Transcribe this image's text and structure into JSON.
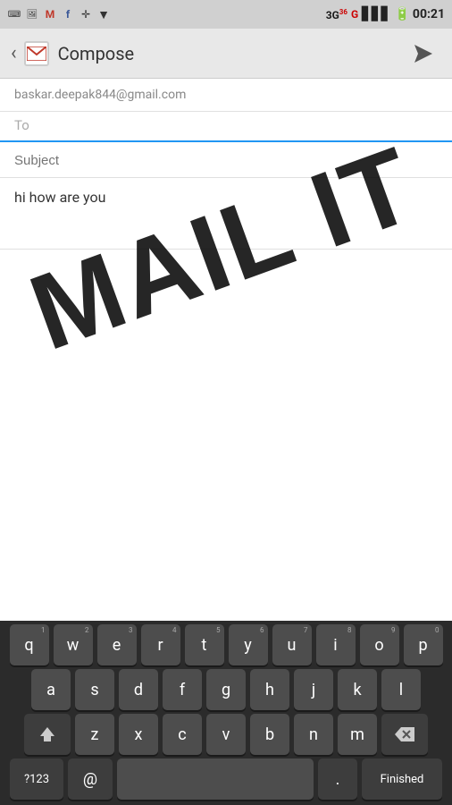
{
  "statusBar": {
    "network": "3G",
    "networkSuperscript": "36",
    "signal": "G",
    "time": "00:21",
    "batteryIcon": "battery"
  },
  "toolbar": {
    "title": "Compose",
    "backIcon": "‹",
    "sendIcon": "send"
  },
  "compose": {
    "from": "baskar.deepak844@gmail.com",
    "toLabel": "To",
    "toPlaceholder": "",
    "subjectPlaceholder": "Subject",
    "bodyText": "hi how are you"
  },
  "watermark": {
    "line1": "MAIL IT"
  },
  "keyboard": {
    "rows": [
      [
        "q",
        "w",
        "e",
        "r",
        "t",
        "y",
        "u",
        "i",
        "o",
        "p"
      ],
      [
        "a",
        "s",
        "d",
        "f",
        "g",
        "h",
        "j",
        "k",
        "l"
      ],
      [
        "z",
        "x",
        "c",
        "v",
        "b",
        "n",
        "m"
      ],
      [
        "?123",
        "@",
        "",
        ".",
        "Finished"
      ]
    ],
    "numbers": [
      "1",
      "2",
      "3",
      "4",
      "5",
      "6",
      "7",
      "8",
      "9",
      "0"
    ]
  }
}
